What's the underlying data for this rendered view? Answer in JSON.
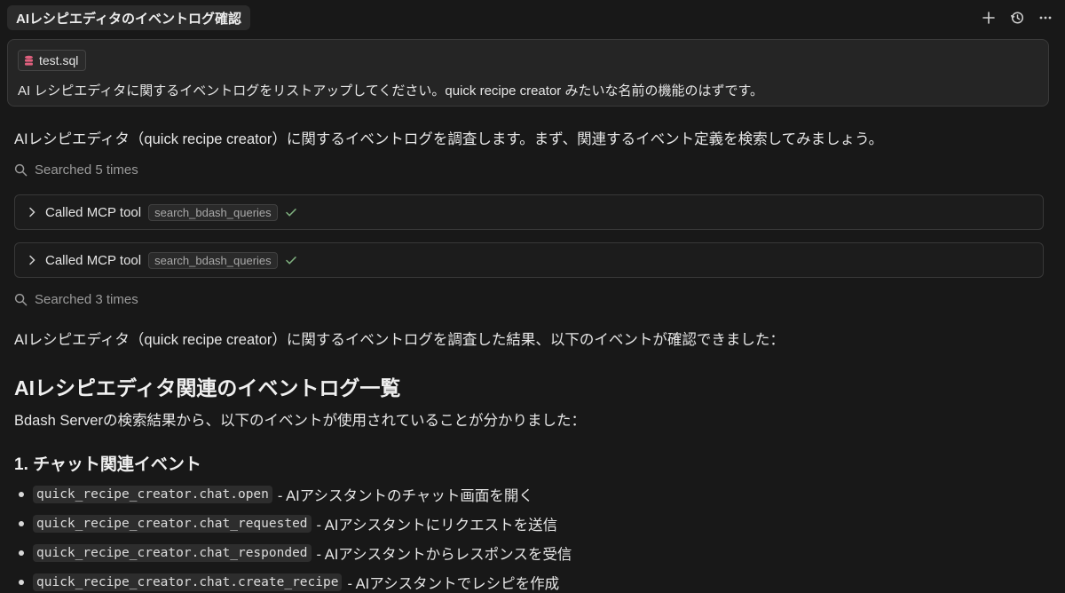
{
  "header": {
    "title": "AIレシピエディタのイベントログ確認",
    "actions": [
      {
        "name": "plus-icon",
        "glyph": "+"
      },
      {
        "name": "history-icon"
      },
      {
        "name": "more-icon"
      }
    ]
  },
  "user_message": {
    "attachment": "test.sql",
    "text": "AI レシピエディタに関するイベントログをリストアップしてください。quick recipe creator みたいな名前の機能のはずです。"
  },
  "conversation": {
    "intro": "AIレシピエディタ（quick recipe creator）に関するイベントログを調査します。まず、関連するイベント定義を検索してみましょう。",
    "searched_1": "Searched 5 times",
    "tool_calls": [
      {
        "label": "Called MCP tool",
        "tool": "search_bdash_queries"
      },
      {
        "label": "Called MCP tool",
        "tool": "search_bdash_queries"
      }
    ],
    "searched_2": "Searched 3 times",
    "result_intro": "AIレシピエディタ（quick recipe creator）に関するイベントログを調査した結果、以下のイベントが確認できました：",
    "heading": "AIレシピエディタ関連のイベントログ一覧",
    "summary": "Bdash Serverの検索結果から、以下のイベントが使用されていることが分かりました：",
    "section_title": "1. チャット関連イベント",
    "events": [
      {
        "code": "quick_recipe_creator.chat.open",
        "desc": "- AIアシスタントのチャット画面を開く"
      },
      {
        "code": "quick_recipe_creator.chat_requested",
        "desc": "- AIアシスタントにリクエストを送信"
      },
      {
        "code": "quick_recipe_creator.chat_responded",
        "desc": "- AIアシスタントからレスポンスを受信"
      },
      {
        "code": "quick_recipe_creator.chat.create_recipe",
        "desc": "- AIアシスタントでレシピを作成"
      }
    ]
  },
  "colors": {
    "background": "#181818",
    "card": "#252525",
    "check": "#7fb07f",
    "db_icon": "#e0607e"
  }
}
